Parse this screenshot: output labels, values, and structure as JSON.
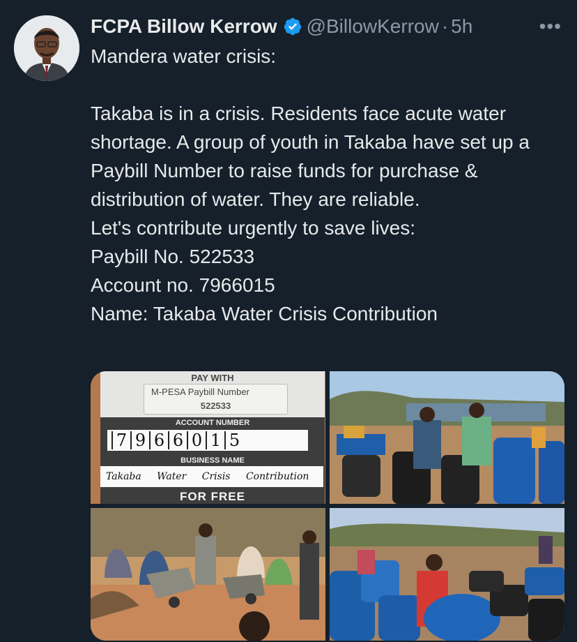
{
  "tweet": {
    "author_name": "FCPA Billow Kerrow",
    "handle": "@BillowKerrow",
    "separator": "·",
    "time": "5h",
    "more_label": "•••",
    "lines": [
      "Mandera water crisis:",
      "Takaba is in a crisis. Residents face acute water shortage. A group of youth in Takaba have set up a Paybill Number to raise funds for purchase & distribution of water. They are reliable.",
      "Let's contribute urgently to save lives:",
      "Paybill No. 522533",
      "Account no. 7966015",
      "Name: Takaba Water Crisis Contribution"
    ]
  },
  "paycard": {
    "pay_with": "PAY WITH",
    "mpesa": "M-PESA  Paybill Number",
    "paybill_number": "522533",
    "account_label": "ACCOUNT NUMBER",
    "account_digits": [
      "7",
      "9",
      "6",
      "6",
      "0",
      "1",
      "5"
    ],
    "business_label": "BUSINESS NAME",
    "business_name": "Takaba Water Crisis Contribution",
    "bottom_text": "FOR FREE"
  },
  "colors": {
    "background": "#15202b",
    "text": "#e7e9ea",
    "muted": "#8b98a5",
    "verified": "#1d9bf0"
  },
  "icons": [
    "verified-badge-icon",
    "more-options-icon"
  ]
}
